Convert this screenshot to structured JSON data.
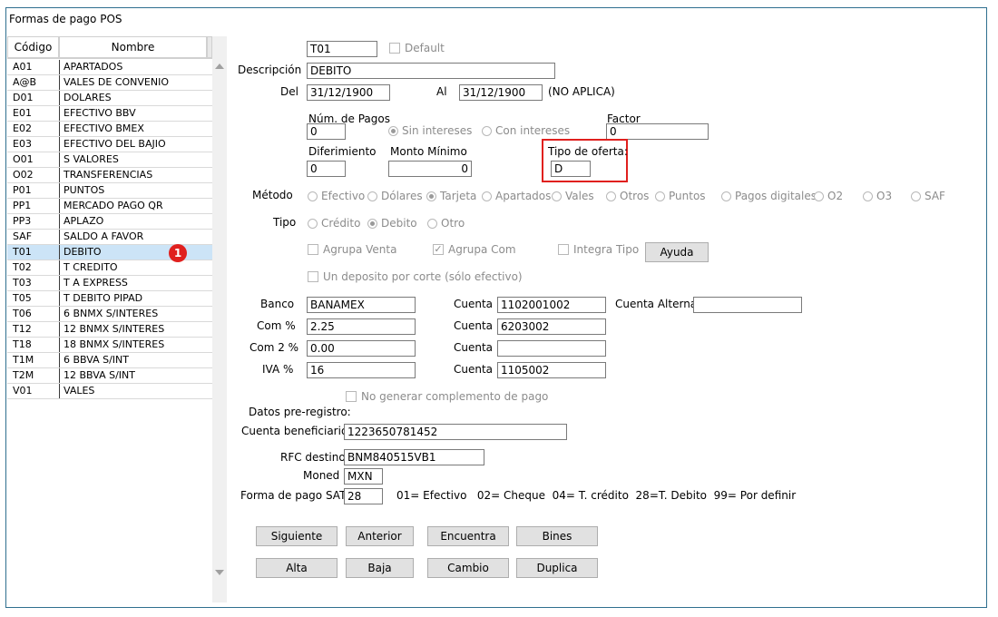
{
  "window": {
    "title": "Formas de pago POS"
  },
  "list": {
    "headers": {
      "codigo": "Código",
      "nombre": "Nombre"
    },
    "rows": [
      {
        "codigo": "A01",
        "nombre": "APARTADOS"
      },
      {
        "codigo": "A@B",
        "nombre": "VALES DE CONVENIO"
      },
      {
        "codigo": "D01",
        "nombre": "DOLARES"
      },
      {
        "codigo": "E01",
        "nombre": "EFECTIVO BBV"
      },
      {
        "codigo": "E02",
        "nombre": "EFECTIVO BMEX"
      },
      {
        "codigo": "E03",
        "nombre": "EFECTIVO DEL BAJIO"
      },
      {
        "codigo": "O01",
        "nombre": "S VALORES"
      },
      {
        "codigo": "O02",
        "nombre": "TRANSFERENCIAS"
      },
      {
        "codigo": "P01",
        "nombre": "PUNTOS"
      },
      {
        "codigo": "PP1",
        "nombre": "MERCADO PAGO QR"
      },
      {
        "codigo": "PP3",
        "nombre": "APLAZO"
      },
      {
        "codigo": "SAF",
        "nombre": "SALDO A FAVOR"
      },
      {
        "codigo": "T01",
        "nombre": "DEBITO"
      },
      {
        "codigo": "T02",
        "nombre": "T CREDITO"
      },
      {
        "codigo": "T03",
        "nombre": "T A EXPRESS"
      },
      {
        "codigo": "T05",
        "nombre": "T DEBITO PIPAD"
      },
      {
        "codigo": "T06",
        "nombre": "6 BNMX S/INTERES"
      },
      {
        "codigo": "T12",
        "nombre": "12 BNMX S/INTERES"
      },
      {
        "codigo": "T18",
        "nombre": "18 BNMX S/INTERES"
      },
      {
        "codigo": "T1M",
        "nombre": "6 BBVA  S/INT"
      },
      {
        "codigo": "T2M",
        "nombre": "12 BBVA S/INT"
      },
      {
        "codigo": "V01",
        "nombre": "VALES"
      }
    ],
    "selected_badge": "1"
  },
  "form": {
    "codigo": "T01",
    "default_label": "Default",
    "descripcion_label": "Descripción",
    "descripcion": "DEBITO",
    "del_label": "Del",
    "del": "31/12/1900",
    "al_label": "Al",
    "al": "31/12/1900",
    "no_aplica": "(NO APLICA)",
    "num_pagos_label": "Núm. de Pagos",
    "num_pagos": "0",
    "sin_intereses": "Sin intereses",
    "con_intereses": "Con intereses",
    "factor_label": "Factor",
    "factor": "0",
    "diferimiento_label": "Diferimiento",
    "diferimiento": "0",
    "monto_minimo_label": "Monto Mínimo",
    "monto_minimo": "0",
    "tipo_oferta_label": "Tipo de oferta:",
    "tipo_oferta": "D",
    "metodo_label": "Método",
    "metodos": [
      "Efectivo",
      "Dólares",
      "Tarjeta",
      "Apartados",
      "Vales",
      "Otros",
      "Puntos",
      "Pagos digitales",
      "O2",
      "O3",
      "SAF"
    ],
    "tipo_label": "Tipo",
    "tipos": [
      "Crédito",
      "Debito",
      "Otro"
    ],
    "agrupa_venta": "Agrupa Venta",
    "agrupa_com": "Agrupa Com",
    "integra_tipo": "Integra Tipo",
    "ayuda": "Ayuda",
    "deposito_por_corte": "Un deposito por corte (sólo efectivo)",
    "banco_label": "Banco",
    "banco": "BANAMEX",
    "cuenta_label": "Cuenta",
    "cuenta1": "1102001002",
    "cuenta_alterna_label": "Cuenta Alterna",
    "cuenta_alterna": "",
    "com_label": "Com %",
    "com": "2.25",
    "cuenta2": "6203002",
    "com2_label": "Com 2 %",
    "com2": "0.00",
    "cuenta3": "",
    "iva_label": "IVA %",
    "iva": "16",
    "cuenta4": "1105002",
    "no_generar": "No generar complemento de pago",
    "datos_preregistro": "Datos pre-registro:",
    "cuenta_benef_label": "Cuenta beneficiario:",
    "cuenta_benef": "1223650781452",
    "rfc_label": "RFC destino",
    "rfc": "BNM840515VB1",
    "moneda_label": "Moned",
    "moneda": "MXN",
    "forma_sat_label": "Forma de pago SAT:",
    "forma_sat": "28",
    "forma_sat_help": "01= Efectivo   02= Cheque  04= T. crédito  28=T. Debito  99= Por definir"
  },
  "buttons": {
    "siguiente": "Siguiente",
    "anterior": "Anterior",
    "encuentra": "Encuentra",
    "bines": "Bines",
    "alta": "Alta",
    "baja": "Baja",
    "cambio": "Cambio",
    "duplica": "Duplica"
  }
}
